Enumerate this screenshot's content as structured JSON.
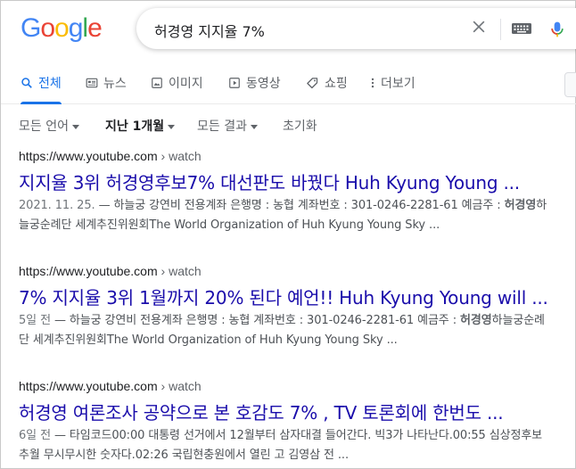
{
  "logo": {
    "text": "Google"
  },
  "search": {
    "query": "허경영 지지율 7%"
  },
  "tabs": [
    {
      "label": "전체",
      "icon": "search-icon"
    },
    {
      "label": "뉴스",
      "icon": "news-icon"
    },
    {
      "label": "이미지",
      "icon": "image-icon"
    },
    {
      "label": "동영상",
      "icon": "video-icon"
    },
    {
      "label": "쇼핑",
      "icon": "tag-icon"
    },
    {
      "label": "더보기",
      "icon": "more-vert-icon"
    }
  ],
  "filters": [
    {
      "label": "모든 언어"
    },
    {
      "label": "지난 1개월"
    },
    {
      "label": "모든 결과"
    },
    {
      "label": "초기화"
    }
  ],
  "results": [
    {
      "cite_domain": "https://www.youtube.com",
      "cite_path": " › watch",
      "title": "지지율 3위 허경영후보7% 대선판도 바꿨다 Huh Kyung Young ...",
      "date": "2021. 11. 25.",
      "snippet_pre": " — 하늘궁 강연비 전용계좌 은행명 : 농협 계좌번호 : 301-0246-2281-61 예금주 : ",
      "snippet_bold": "허경영",
      "snippet_post": "하늘궁순례단 세계추진위원회The World Organization of Huh Kyung Young Sky ..."
    },
    {
      "cite_domain": "https://www.youtube.com",
      "cite_path": " › watch",
      "title": "7% 지지율 3위 1월까지 20% 된다 예언!! Huh Kyung Young will ...",
      "date": "5일 전",
      "snippet_pre": " — 하늘궁 강연비 전용계좌 은행명 : 농협 계좌번호 : 301-0246-2281-61 예금주 : ",
      "snippet_bold": "허경영",
      "snippet_post": "하늘궁순례단 세계추진위원회The World Organization of Huh Kyung Young Sky ..."
    },
    {
      "cite_domain": "https://www.youtube.com",
      "cite_path": " › watch",
      "title": "허경영 여론조사 공약으로 본 호감도 7% , TV 토론회에 한번도 ...",
      "date": "6일 전",
      "snippet_pre": " — 타임코드00:00 대통령 선거에서 12월부터 삼자대결 들어간다. 빅3가 나타난다.00:55 심상정후보 추월 무시무시한 숫자다.02:26 국립현충원에서 열린 고 김영삼 전 ...",
      "snippet_bold": "",
      "snippet_post": ""
    }
  ],
  "colors": {
    "link": "#1a0dab",
    "accent": "#1a73e8",
    "google_blue": "#4285f4",
    "google_red": "#ea4335",
    "google_yellow": "#fbbc05",
    "google_green": "#34a853"
  }
}
